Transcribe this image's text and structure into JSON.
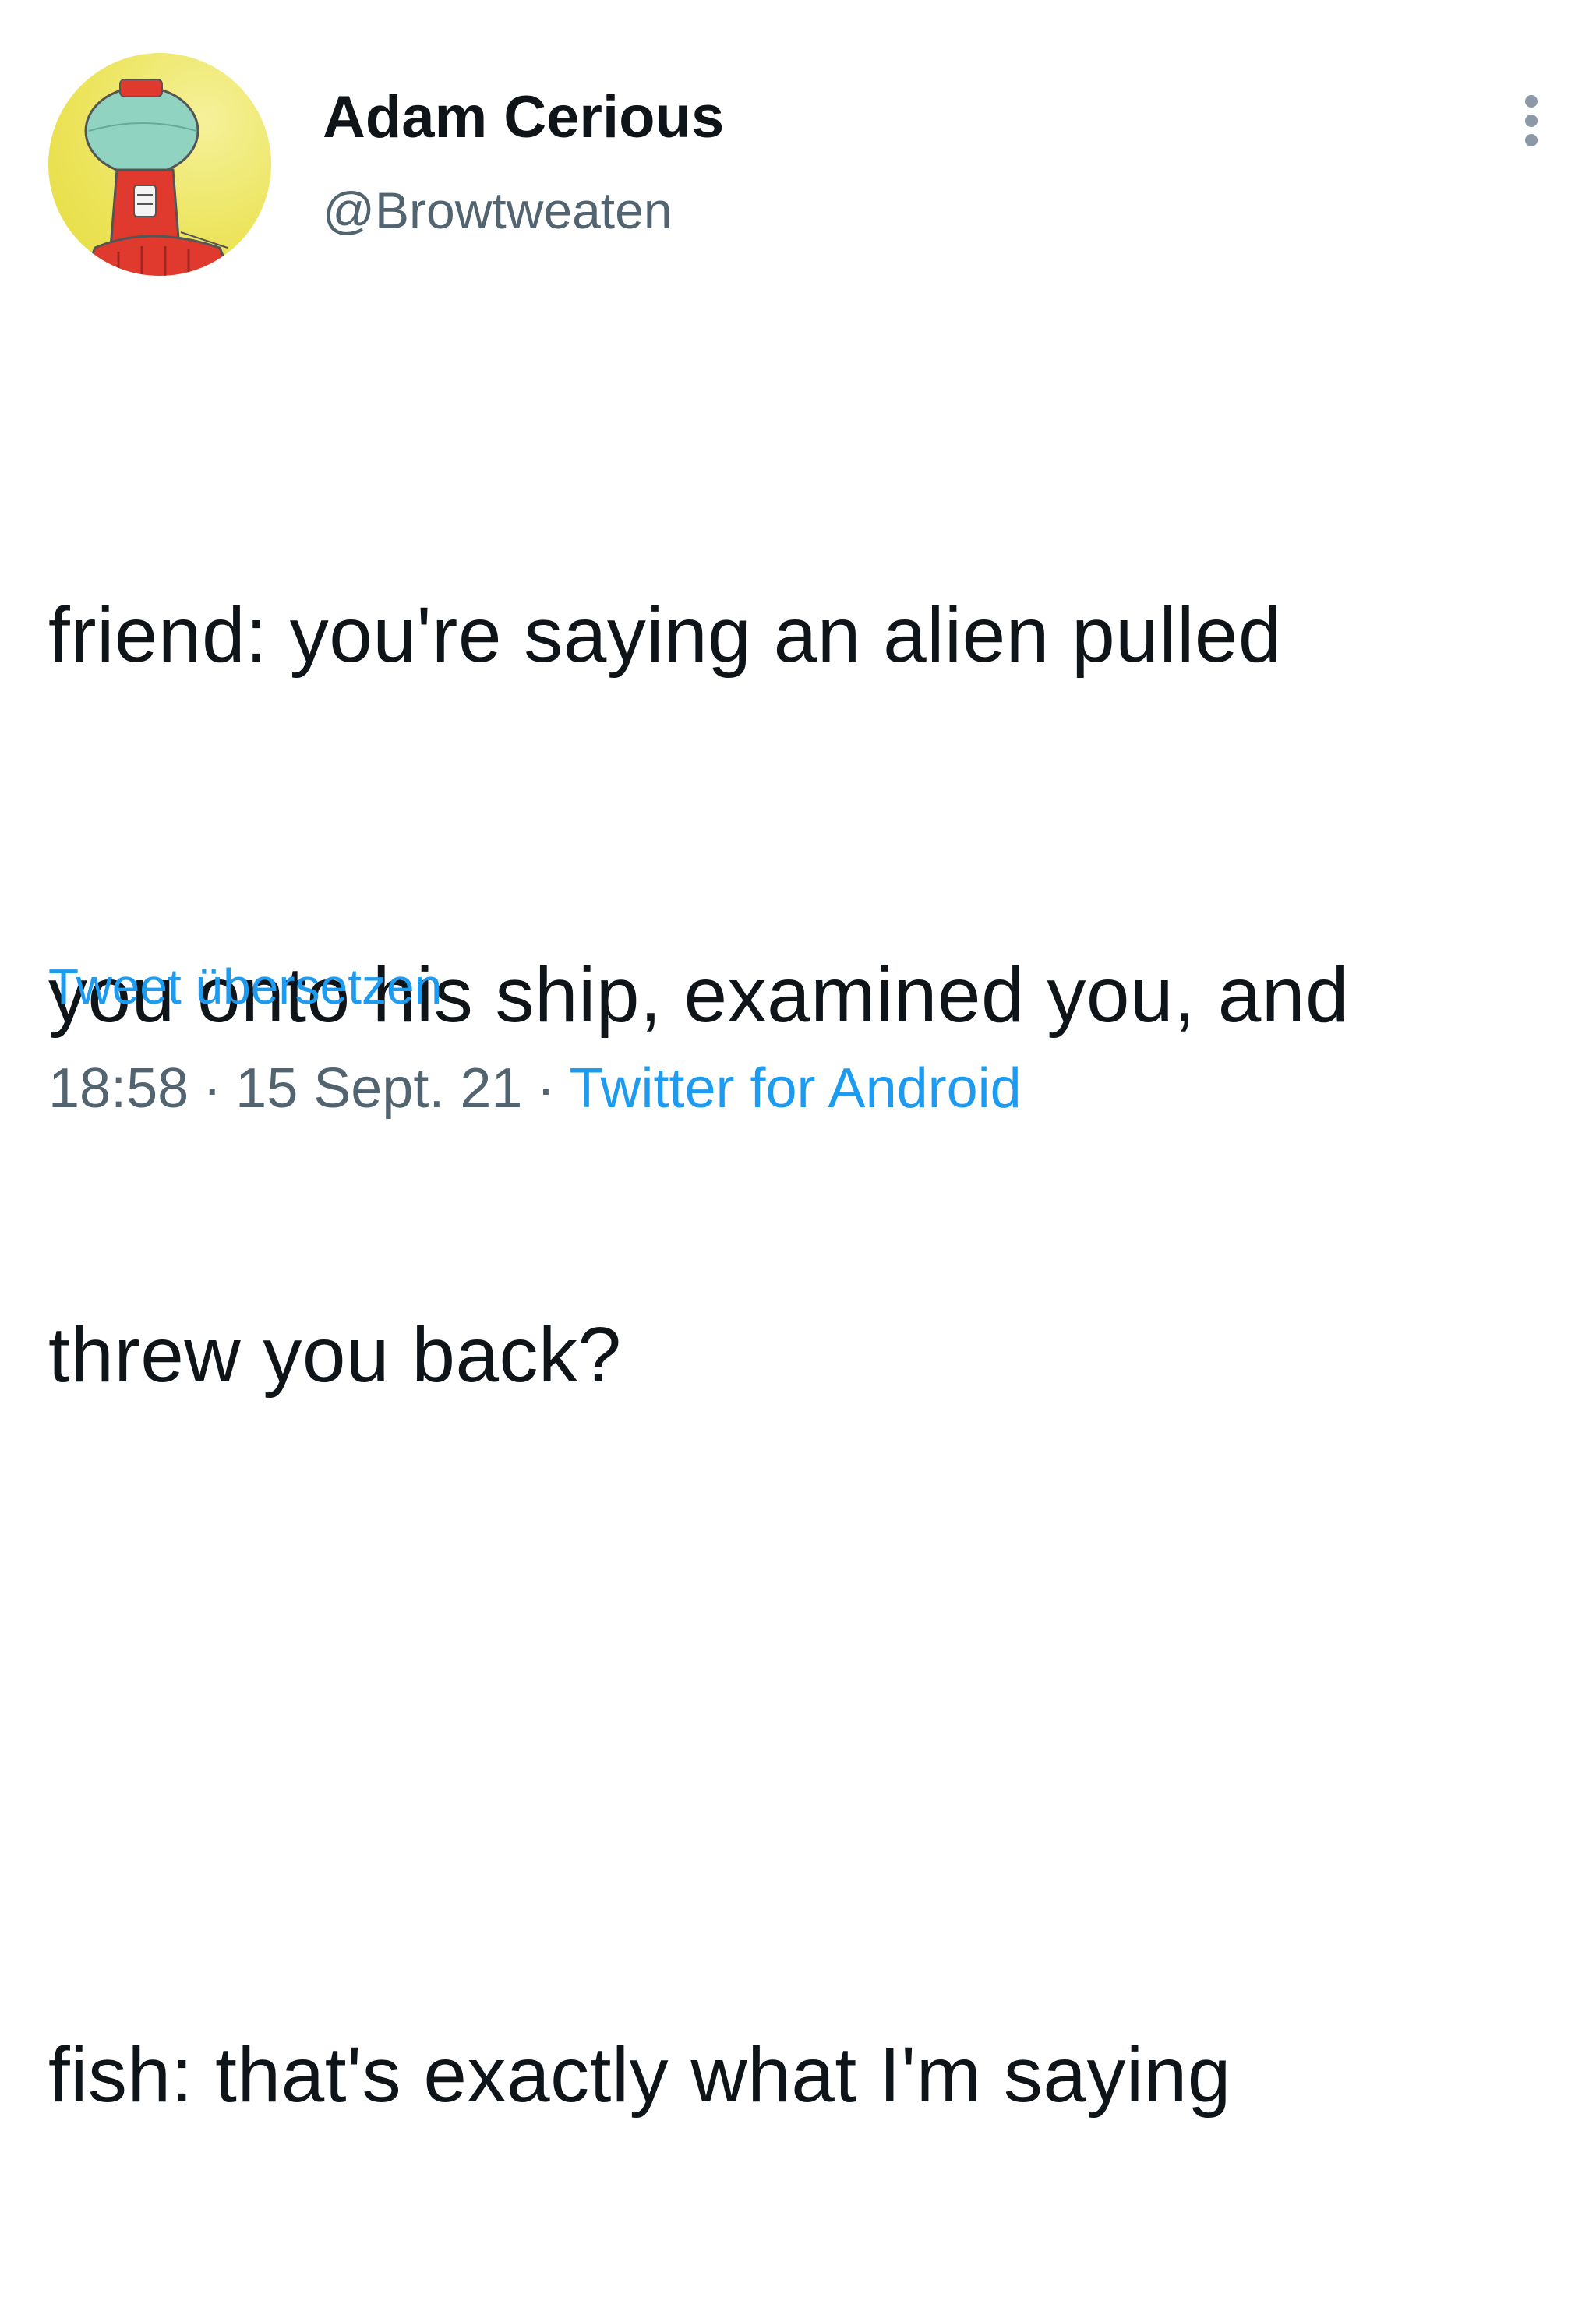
{
  "author": {
    "display_name": "Adam Cerious",
    "handle": "@Browtweaten",
    "avatar_icon": "robot-gumball-avatar"
  },
  "menu": {
    "icon": "more-vertical-icon"
  },
  "tweet": {
    "lines": [
      "friend: you're saying an alien pulled",
      "you onto his ship, examined you, and",
      "threw you back?",
      "",
      "fish: that's exactly what I'm saying"
    ],
    "translate_label": "Tweet übersetzen",
    "time": "18:58",
    "separator": "·",
    "date": "15 Sept. 21",
    "source": "Twitter for Android"
  },
  "colors": {
    "text": "#0f1419",
    "secondary": "#536471",
    "link": "#1d9bf0",
    "avatar_bg": "#ece45c"
  }
}
